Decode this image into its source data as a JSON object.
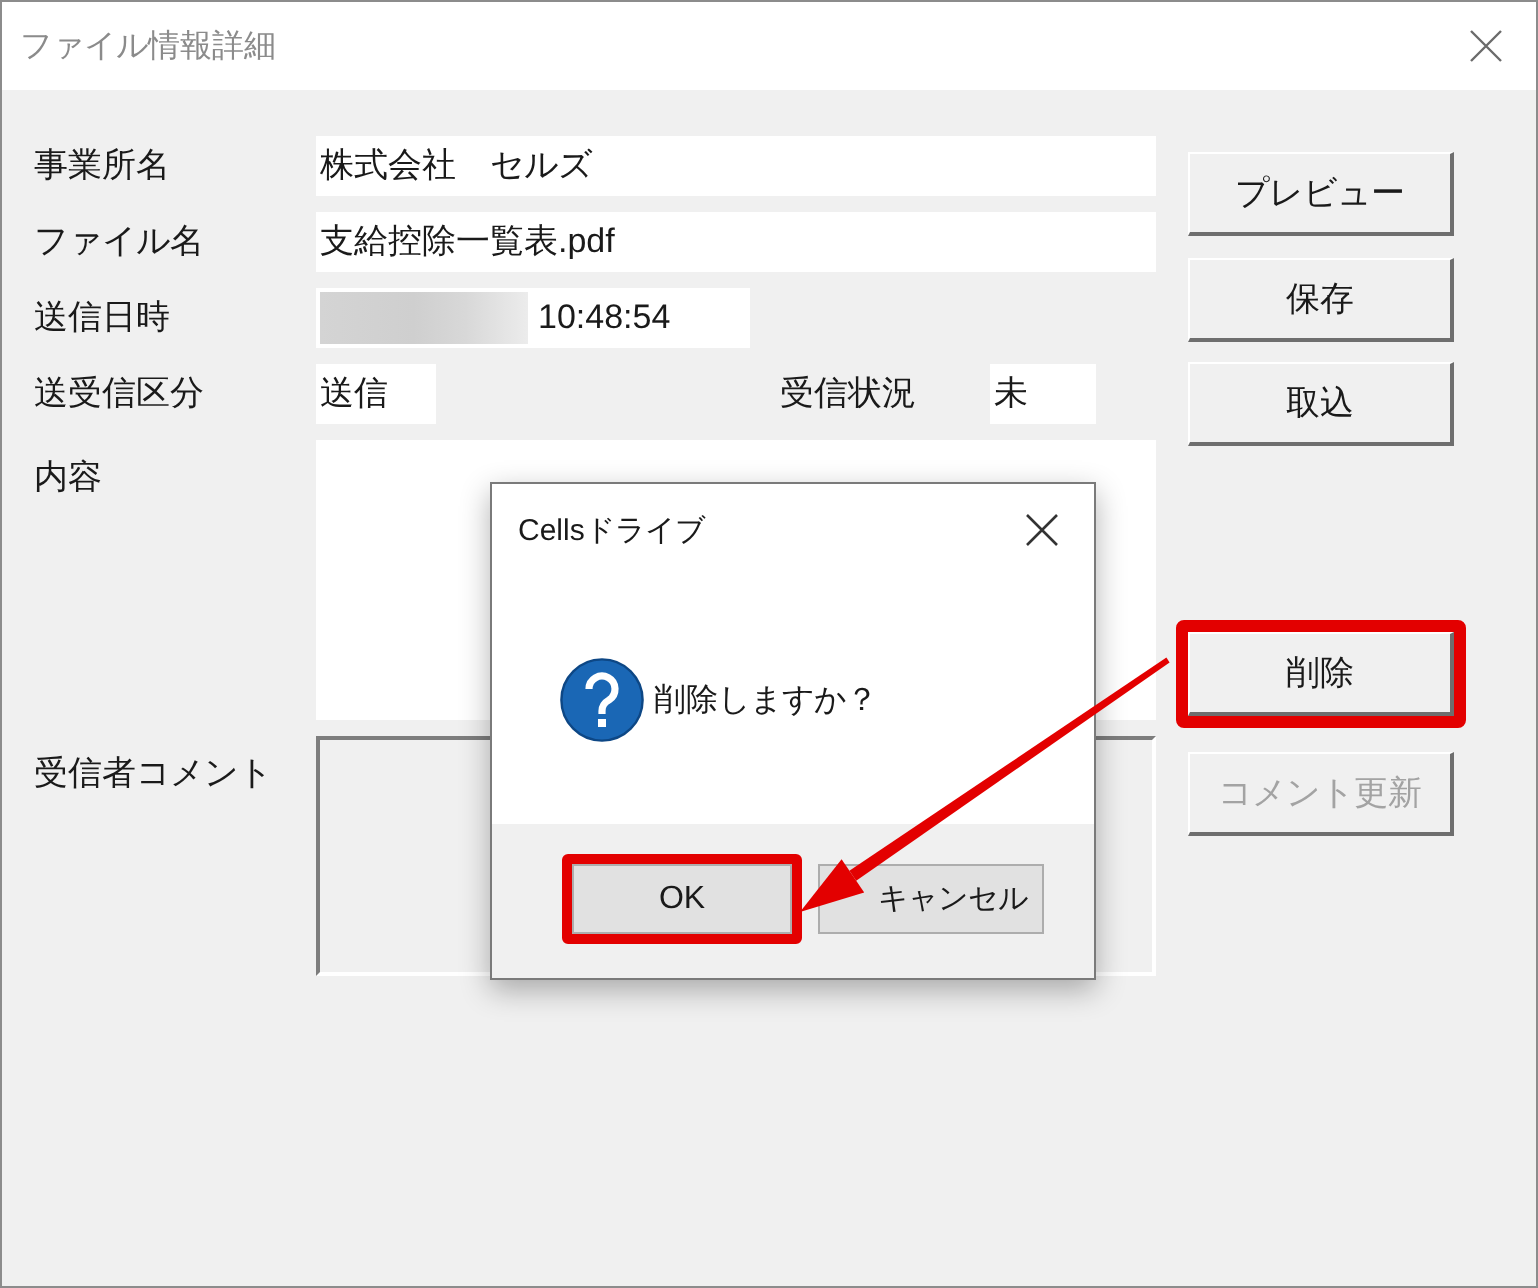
{
  "window": {
    "title": "ファイル情報詳細"
  },
  "fields": [
    {
      "label": "事業所名",
      "kind": "text",
      "value": "株式会社　セルズ",
      "disabled": false
    },
    {
      "label": "ファイル名",
      "kind": "text",
      "value": "支給控除一覧表.pdf",
      "disabled": false
    },
    {
      "label": "送信日時",
      "kind": "datetime",
      "value": "10:48:54",
      "redacted_prefix": true,
      "disabled": false
    },
    {
      "label": "送受信区分",
      "kind": "pair",
      "value": "送信",
      "second_label": "受信状況",
      "second_value": "未",
      "disabled": false
    },
    {
      "label": "内容",
      "kind": "multiline",
      "disabled": false
    },
    {
      "label": "受信者コメント",
      "kind": "multiline",
      "disabled": true
    }
  ],
  "buttons": [
    {
      "label": "プレビュー",
      "disabled": false,
      "highlighted": false
    },
    {
      "label": "保存",
      "disabled": false,
      "highlighted": false
    },
    {
      "label": "取込",
      "disabled": false,
      "highlighted": false
    },
    {
      "label": "削除",
      "disabled": false,
      "highlighted": true
    },
    {
      "label": "コメント更新",
      "disabled": true,
      "highlighted": false
    }
  ],
  "dialog": {
    "title": "Cellsドライブ",
    "message": "削除しますか？",
    "buttons": [
      {
        "label": "OK",
        "highlighted": true
      },
      {
        "label": "キャンセル",
        "highlighted": false
      }
    ]
  }
}
